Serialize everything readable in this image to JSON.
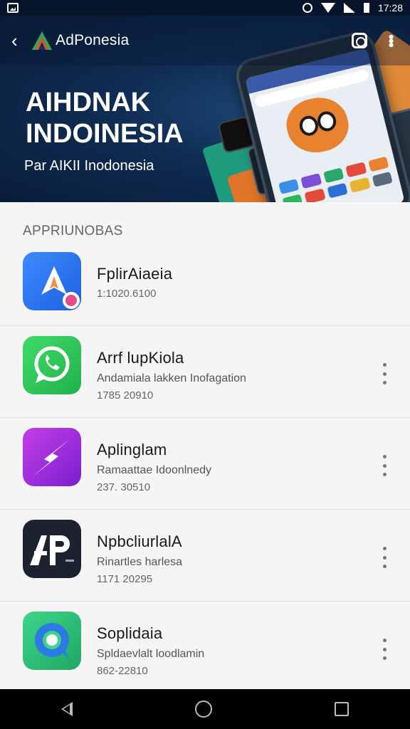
{
  "status_bar": {
    "time": "17:28"
  },
  "toolbar": {
    "title": "AdPonesia"
  },
  "hero": {
    "title_line1": "AIHDNAK",
    "title_line2": "INDOINESIA",
    "subtitle": "Par AIKII Inodonesia"
  },
  "section": {
    "header": "APPRIUNOBAS"
  },
  "apps": [
    {
      "name": "FplirAiaeia",
      "description": "",
      "meta": "1:1020.6100",
      "icon": "blue-arrow-icon",
      "has_menu": false
    },
    {
      "name": "Arrf lupKiola",
      "description": "Andamiala lakken Inofagation",
      "meta": "1785 20910",
      "icon": "whatsapp-like-icon",
      "has_menu": true
    },
    {
      "name": "Aplinglam",
      "description": "Ramaattae Idoonlnedy",
      "meta": "237. 30510",
      "icon": "purple-arrow-icon",
      "has_menu": true
    },
    {
      "name": "NpbcliurlalA",
      "description": "Rinartles harlesa",
      "meta": "1171 20295",
      "icon": "ap-logo-icon",
      "has_menu": true
    },
    {
      "name": "Soplidaia",
      "description": "Spldaevlalt loodlamin",
      "meta": "862-22810",
      "icon": "green-chat-icon",
      "has_menu": true
    }
  ],
  "colors": {
    "hero_bg": "#0f2c52",
    "accent_orange": "#e0742a",
    "accent_green": "#1f9a7c"
  }
}
